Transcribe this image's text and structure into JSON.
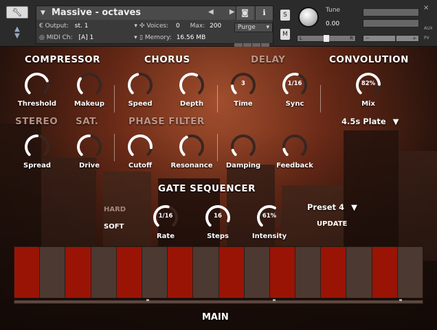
{
  "header": {
    "instrument_name": "Massive - octaves",
    "output_label": "Output:",
    "output_value": "st. 1",
    "voices_label": "Voices:",
    "voices_value": "0",
    "max_label": "Max:",
    "max_value": "200",
    "purge_label": "Purge",
    "midi_label": "MIDI Ch:",
    "midi_value": "[A] 1",
    "memory_label": "Memory:",
    "memory_value": "16.56 MB",
    "solo_label": "S",
    "mute_label": "M",
    "tune_label": "Tune",
    "tune_value": "0.00",
    "pan_left": "L",
    "pan_right": "R",
    "vol_minus": "−",
    "vol_plus": "+",
    "aux_label": "AUX",
    "pv_label": "PV",
    "close_glyph": "×",
    "prev_next_glyph": "◀ ▶"
  },
  "sections": {
    "compressor": "COMPRESSOR",
    "chorus": "CHORUS",
    "delay": "DELAY",
    "convolution": "CONVOLUTION",
    "stereo": "STEREO",
    "sat": "SAT.",
    "phase_filter": "PHASE FILTER",
    "gate_sequencer": "GATE SEQUENCER"
  },
  "knobs": {
    "threshold": {
      "label": "Threshold",
      "value": "",
      "level": 0.75
    },
    "makeup": {
      "label": "Makeup",
      "value": "",
      "level": 0.3
    },
    "speed": {
      "label": "Speed",
      "value": "",
      "level": 0.45
    },
    "depth": {
      "label": "Depth",
      "value": "",
      "level": 0.6
    },
    "time": {
      "label": "Time",
      "value": "3",
      "level": 0.15
    },
    "sync": {
      "label": "Sync",
      "value": "1/16",
      "level": 0.55
    },
    "mix": {
      "label": "Mix",
      "value": "82%",
      "level": 0.82
    },
    "spread": {
      "label": "Spread",
      "value": "",
      "level": 0.5
    },
    "drive": {
      "label": "Drive",
      "value": "",
      "level": 0.5
    },
    "cutoff": {
      "label": "Cutoff",
      "value": "",
      "level": 0.85
    },
    "resonance": {
      "label": "Resonance",
      "value": "",
      "level": 0.4
    },
    "damping": {
      "label": "Damping",
      "value": "",
      "level": 0.1
    },
    "feedback": {
      "label": "Feedback",
      "value": "",
      "level": 0.12
    },
    "rate": {
      "label": "Rate",
      "value": "1/16",
      "level": 0.55
    },
    "steps": {
      "label": "Steps",
      "value": "16",
      "level": 0.9
    },
    "intensity": {
      "label": "Intensity",
      "value": "61%",
      "level": 0.61
    }
  },
  "convolution_ir": "4.5s Plate",
  "gate": {
    "hard_label": "HARD",
    "soft_label": "SOFT",
    "preset_label": "Preset 4",
    "update_label": "UPDATE",
    "steps": [
      1,
      0,
      1,
      0,
      1,
      0,
      1,
      0,
      1,
      0,
      1,
      0,
      1,
      0,
      1,
      0
    ]
  },
  "page_label": "MAIN",
  "colors": {
    "step_on": "#9a1406",
    "step_off": "#4c3932",
    "knob_arc": "#ffffff",
    "knob_track": "#3a2620"
  }
}
